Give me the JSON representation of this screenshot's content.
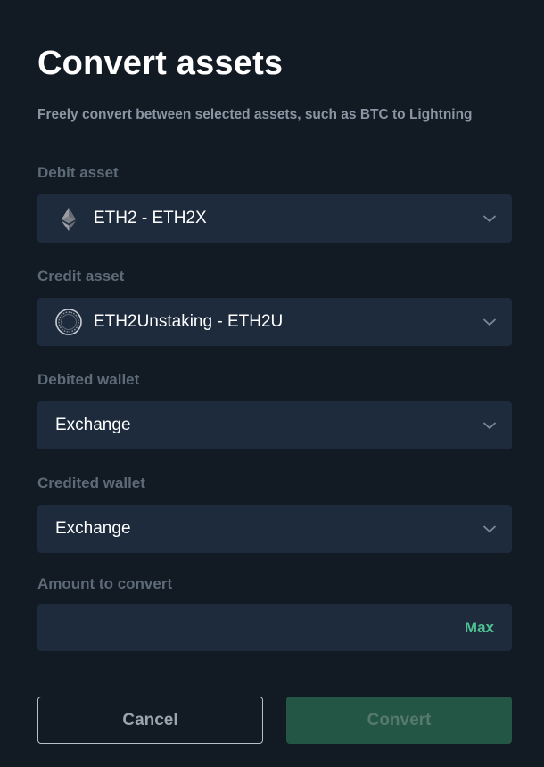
{
  "header": {
    "title": "Convert assets",
    "subtitle": "Freely convert between selected assets, such as BTC to Lightning"
  },
  "form": {
    "debit_asset": {
      "label": "Debit asset",
      "value": "ETH2 - ETH2X",
      "icon": "ethereum-icon"
    },
    "credit_asset": {
      "label": "Credit asset",
      "value": "ETH2Unstaking - ETH2U",
      "icon": "ring-coin-icon"
    },
    "debited_wallet": {
      "label": "Debited wallet",
      "value": "Exchange"
    },
    "credited_wallet": {
      "label": "Credited wallet",
      "value": "Exchange"
    },
    "amount": {
      "label": "Amount to convert",
      "value": "",
      "placeholder": "",
      "max_label": "Max"
    }
  },
  "actions": {
    "cancel_label": "Cancel",
    "convert_label": "Convert"
  },
  "colors": {
    "background": "#121a24",
    "field": "#1d2b3d",
    "accent_green": "#4fbf90",
    "convert_button_disabled": "#245646"
  }
}
